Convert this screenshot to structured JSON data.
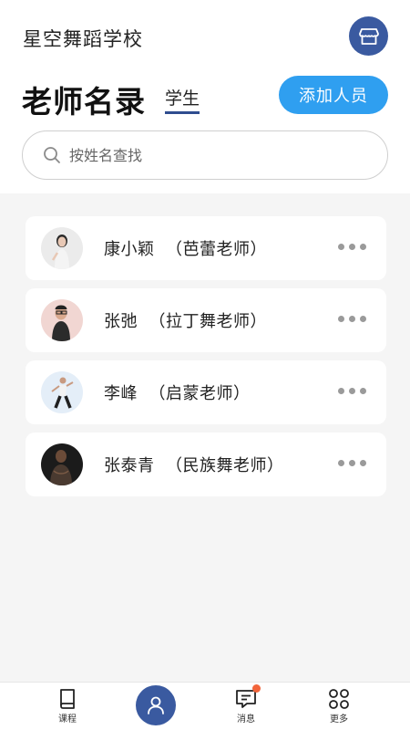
{
  "header": {
    "school_name": "星空舞蹈学校",
    "title": "老师名录",
    "students_tab": "学生",
    "add_button": "添加人员",
    "store_icon": "storefront-icon"
  },
  "search": {
    "placeholder": "按姓名查找",
    "value": ""
  },
  "teachers": [
    {
      "name": "康小颖",
      "role": "芭蕾老师",
      "display": "康小颖  （芭蕾老师）",
      "avatar_colors": [
        "#e8e8e8",
        "#2a2a2a"
      ]
    },
    {
      "name": "张弛",
      "role": "拉丁舞老师",
      "display": "张弛  （拉丁舞老师）",
      "avatar_colors": [
        "#f1d6d2",
        "#2b2b2b"
      ]
    },
    {
      "name": "李峰",
      "role": "启蒙老师",
      "display": "李峰  （启蒙老师）",
      "avatar_colors": [
        "#e4eef8",
        "#202020"
      ]
    },
    {
      "name": "张泰青",
      "role": "民族舞老师",
      "display": "张泰青  （民族舞老师）",
      "avatar_colors": [
        "#1b1b1b",
        "#7a5a45"
      ]
    }
  ],
  "nav": {
    "courses": "课程",
    "messages": "消息",
    "more": "更多",
    "center_icon": "user-icon"
  },
  "colors": {
    "primary_blue": "#3a5aa0",
    "accent_blue": "#2f9ff0",
    "badge_red": "#f2643a"
  }
}
